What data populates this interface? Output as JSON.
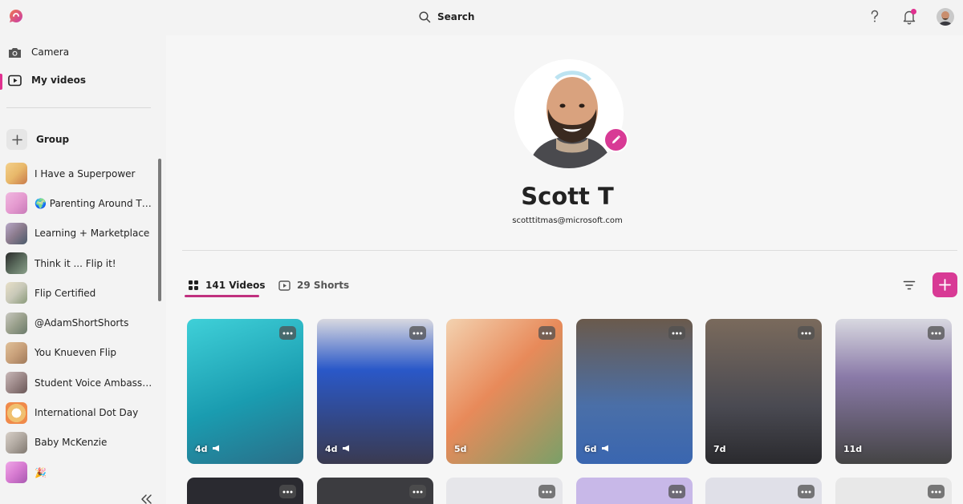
{
  "header": {
    "search_label": "Search"
  },
  "sidebar": {
    "nav": [
      {
        "label": "Camera",
        "icon": "camera-icon"
      },
      {
        "label": "My videos",
        "icon": "video-library-icon",
        "active": true
      }
    ],
    "group_label": "Group",
    "groups": [
      {
        "label": "I Have a Superpower",
        "color": "#e8b86a"
      },
      {
        "label": "🌍 Parenting Around The ...",
        "color": "#e59bd0"
      },
      {
        "label": "Learning + Marketplace",
        "color": "#8a7a8c"
      },
      {
        "label": "Think it ... Flip it!",
        "color": "#5a6a5c"
      },
      {
        "label": "Flip Certified",
        "color": "#c8c8b8"
      },
      {
        "label": "@AdamShortShorts",
        "color": "#9aa08c"
      },
      {
        "label": "You Knueven Flip",
        "color": "#c8a07a"
      },
      {
        "label": "Student Voice Ambassad...",
        "color": "#9c8888"
      },
      {
        "label": "International Dot Day",
        "color": "#f0c070"
      },
      {
        "label": "Baby McKenzie",
        "color": "#b0a8a0"
      },
      {
        "label": "🎉",
        "color": "#d67ad0"
      }
    ]
  },
  "profile": {
    "name": "Scott T",
    "email": "scotttitmas@microsoft.com"
  },
  "tabs": {
    "videos": "141 Videos",
    "shorts": "29 Shorts"
  },
  "videos": [
    {
      "age": "4d",
      "announce": true,
      "bg": "linear-gradient(160deg,#3fd0d8,#1a9cb0 55%,#2a6e88)"
    },
    {
      "age": "4d",
      "announce": true,
      "bg": "linear-gradient(180deg,#d8d8e0 0%,#2a58c8 35%,#3a3a50 100%)"
    },
    {
      "age": "5d",
      "announce": false,
      "bg": "linear-gradient(135deg,#f3d2b0,#e88a5a 45%,#7aa068)"
    },
    {
      "age": "6d",
      "announce": true,
      "bg": "linear-gradient(180deg,#6a5a4c 0%,#4a6fa8 60%,#3a66b0 100%)"
    },
    {
      "age": "7d",
      "announce": false,
      "bg": "linear-gradient(180deg,#7a6a5c 0%,#4a4a52 60%,#2a2a2e 100%)"
    },
    {
      "age": "11d",
      "announce": false,
      "bg": "linear-gradient(180deg,#d8d8e0 0%,#8a7aa8 40%,#444 100%)"
    }
  ],
  "videos_row2": [
    {
      "bg": "#2a2a30"
    },
    {
      "bg": "#3c3c40"
    },
    {
      "bg": "#e6e6ea"
    },
    {
      "bg": "#c8b8e8"
    },
    {
      "bg": "#e0e0e8"
    },
    {
      "bg": "#e8e8e8"
    }
  ]
}
